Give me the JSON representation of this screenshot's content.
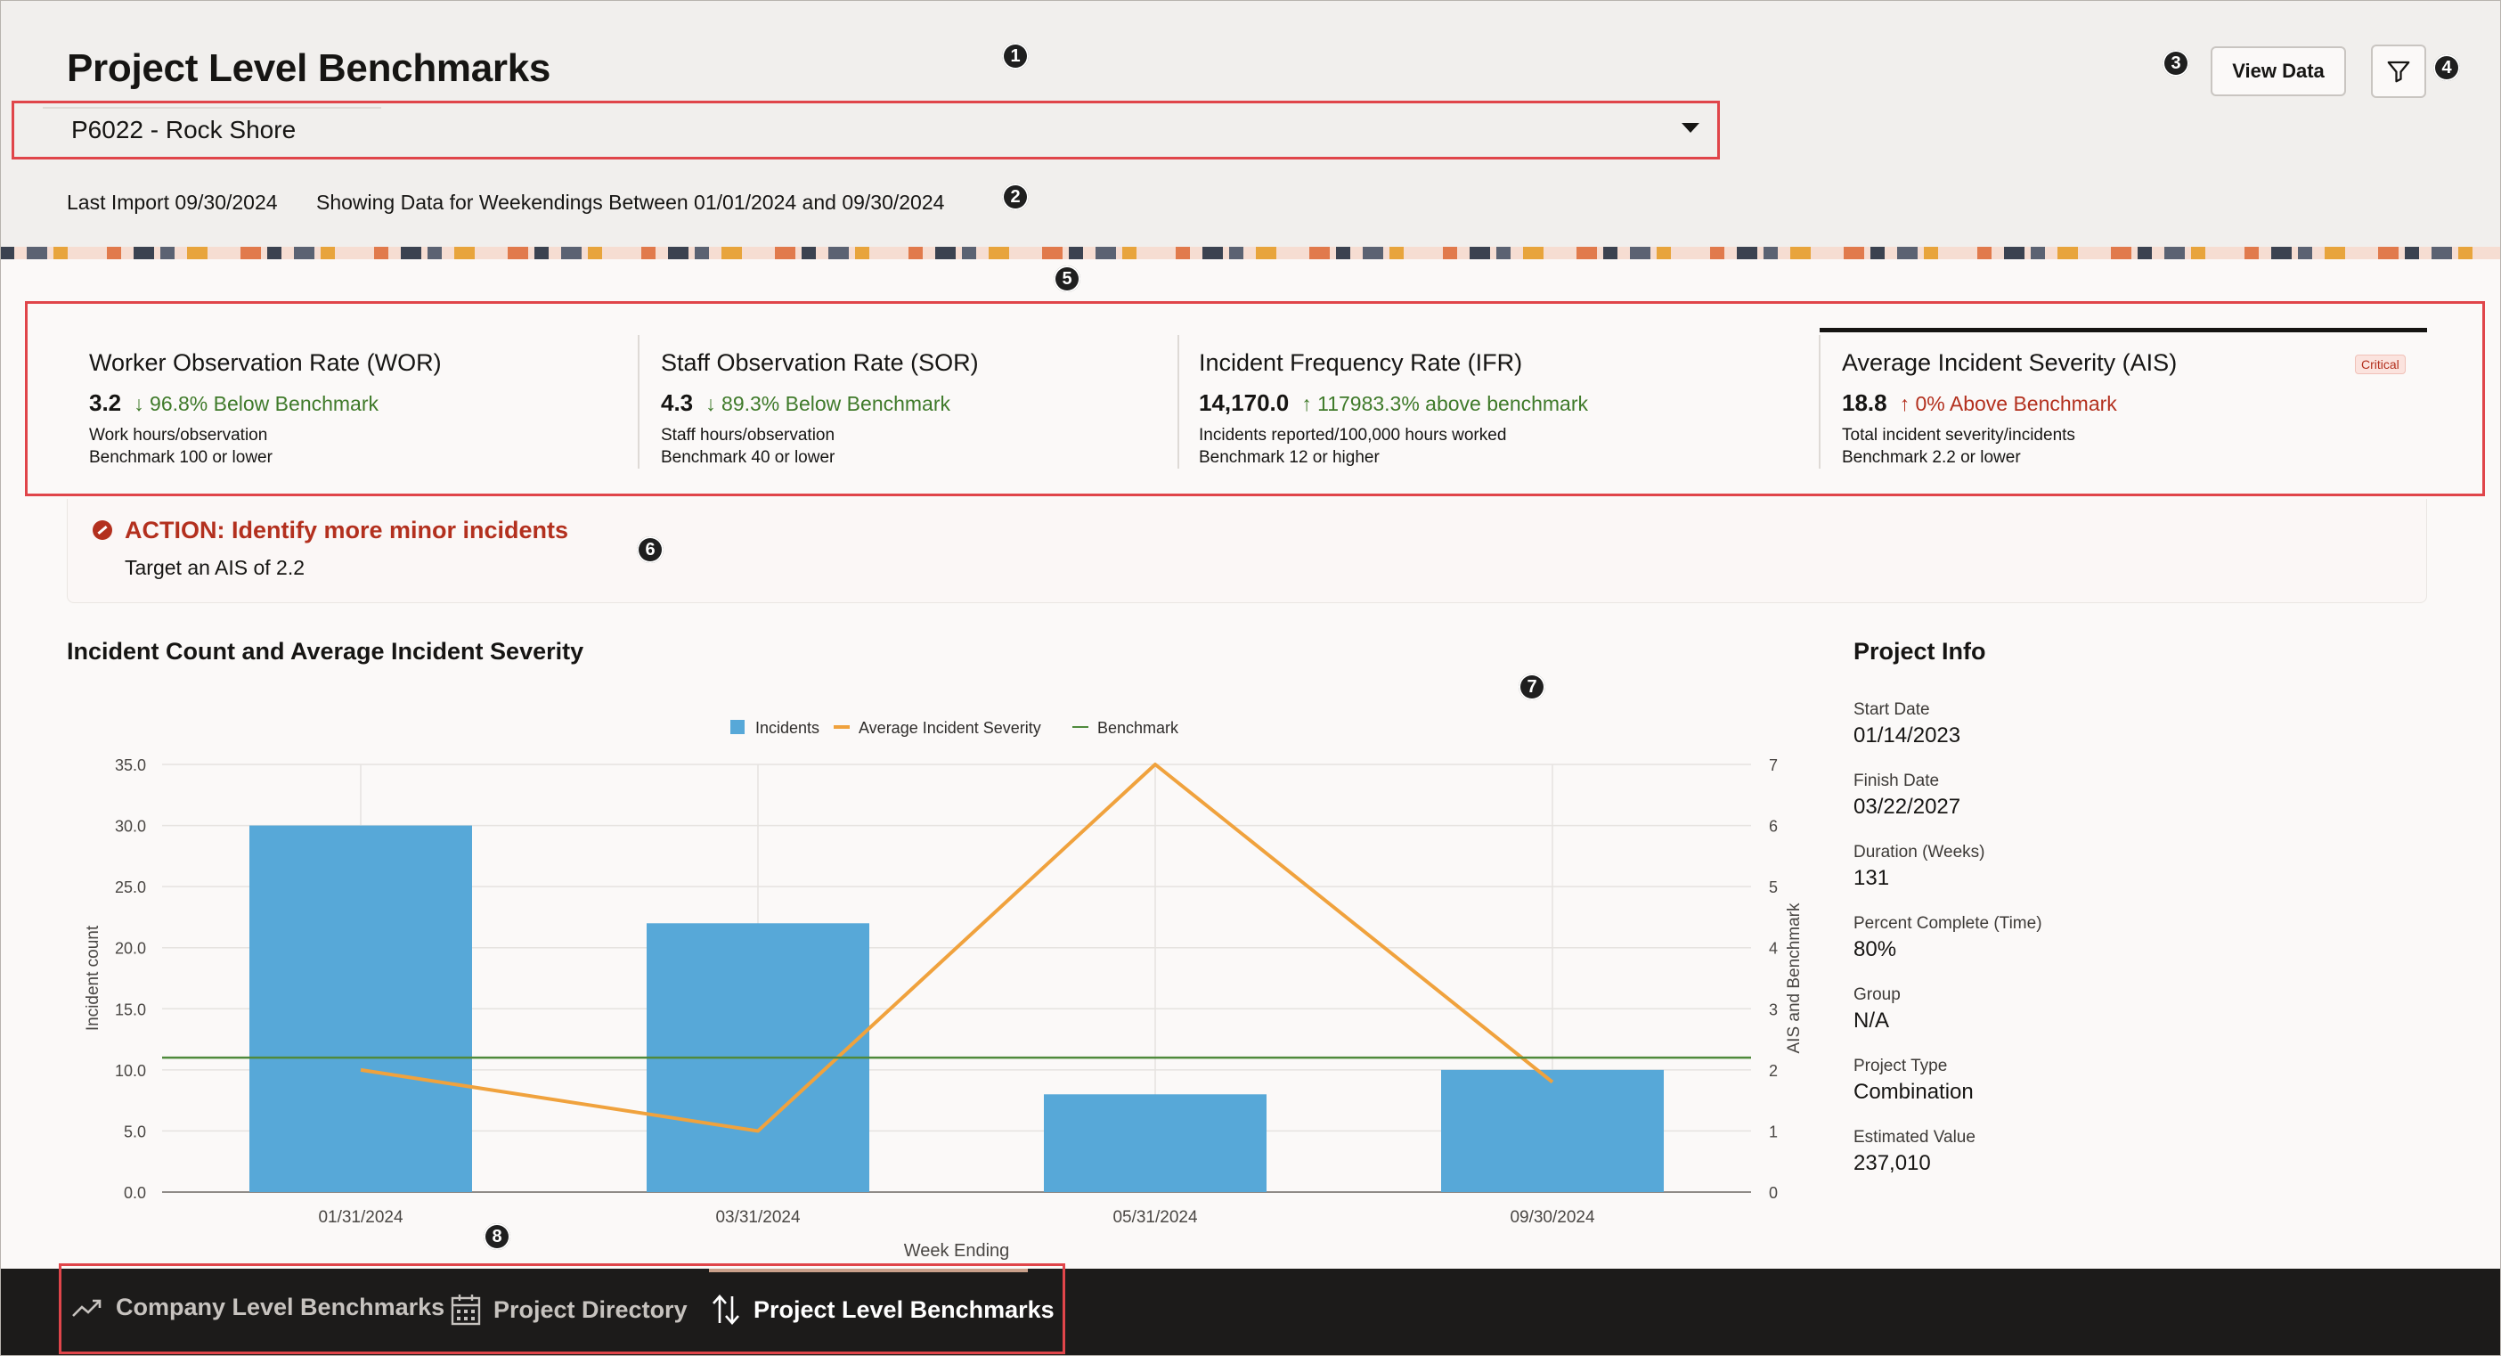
{
  "page": {
    "title": "Project Level Benchmarks",
    "project_selector": "P6022 - Rock Shore",
    "last_import": "Last Import 09/30/2024",
    "showing_data": "Showing Data for Weekendings Between 01/01/2024 and 09/30/2024",
    "view_data_label": "View Data"
  },
  "callouts": [
    "1",
    "2",
    "3",
    "4",
    "5",
    "6",
    "7",
    "8"
  ],
  "metrics": [
    {
      "title": "Worker Observation Rate (WOR)",
      "value": "3.2",
      "delta": "96.8% Below Benchmark",
      "direction": "down",
      "status_color": "#3f7a2a",
      "line1": "Work hours/observation",
      "line2": "Benchmark 100 or lower"
    },
    {
      "title": "Staff Observation Rate (SOR)",
      "value": "4.3",
      "delta": "89.3% Below Benchmark",
      "direction": "down",
      "status_color": "#3f7a2a",
      "line1": "Staff hours/observation",
      "line2": "Benchmark 40 or lower"
    },
    {
      "title": "Incident Frequency Rate (IFR)",
      "value": "14,170.0",
      "delta": "117983.3% above benchmark",
      "direction": "up",
      "status_color": "#3f7a2a",
      "line1": "Incidents reported/100,000 hours worked",
      "line2": "Benchmark 12 or higher"
    },
    {
      "title": "Average Incident Severity (AIS)",
      "value": "18.8",
      "delta": "0% Above Benchmark",
      "direction": "up",
      "status_color": "#b3301e",
      "line1": "Total incident severity/incidents",
      "line2": "Benchmark 2.2 or lower",
      "badge": "Critical"
    }
  ],
  "action": {
    "title": "ACTION: Identify more minor incidents",
    "subtitle": "Target an AIS of 2.2"
  },
  "chart_section_title": "Incident Count and Average Incident Severity",
  "chart_data": {
    "type": "bar",
    "categories": [
      "01/31/2024",
      "03/31/2024",
      "05/31/2024",
      "09/30/2024"
    ],
    "series": [
      {
        "name": "Incidents",
        "kind": "bar",
        "axis": "left",
        "color": "#57a8d8",
        "values": [
          30,
          22,
          8,
          10
        ]
      },
      {
        "name": "Average Incident Severity",
        "kind": "line",
        "axis": "right",
        "color": "#f0a23d",
        "values": [
          2,
          1,
          7,
          1.8
        ]
      },
      {
        "name": "Benchmark",
        "kind": "line",
        "axis": "right",
        "color": "#4f8a3c",
        "values": [
          2.2,
          2.2,
          2.2,
          2.2
        ]
      }
    ],
    "xlabel": "Week Ending",
    "ylabel": "Incident count",
    "y2label": "AIS and Benchmark",
    "ylim": [
      0,
      35
    ],
    "y2lim": [
      0,
      7
    ],
    "yticks": [
      "0.0",
      "5.0",
      "10.0",
      "15.0",
      "20.0",
      "25.0",
      "30.0",
      "35.0"
    ],
    "y2ticks": [
      "0",
      "1",
      "2",
      "3",
      "4",
      "5",
      "6",
      "7"
    ],
    "legend_position": "top-center",
    "grid": true
  },
  "project_info": {
    "title": "Project Info",
    "items": [
      {
        "label": "Start Date",
        "value": "01/14/2023"
      },
      {
        "label": "Finish Date",
        "value": "03/22/2027"
      },
      {
        "label": "Duration (Weeks)",
        "value": "131"
      },
      {
        "label": "Percent Complete (Time)",
        "value": "80%"
      },
      {
        "label": "Group",
        "value": "N/A"
      },
      {
        "label": "Project Type",
        "value": "Combination"
      },
      {
        "label": "Estimated Value",
        "value": "237,010"
      }
    ]
  },
  "footer_nav": [
    {
      "label": "Company Level Benchmarks",
      "icon": "trend-up-icon",
      "active": false
    },
    {
      "label": "Project Directory",
      "icon": "calendar-icon",
      "active": false
    },
    {
      "label": "Project Level Benchmarks",
      "icon": "sort-arrows-icon",
      "active": true
    }
  ]
}
